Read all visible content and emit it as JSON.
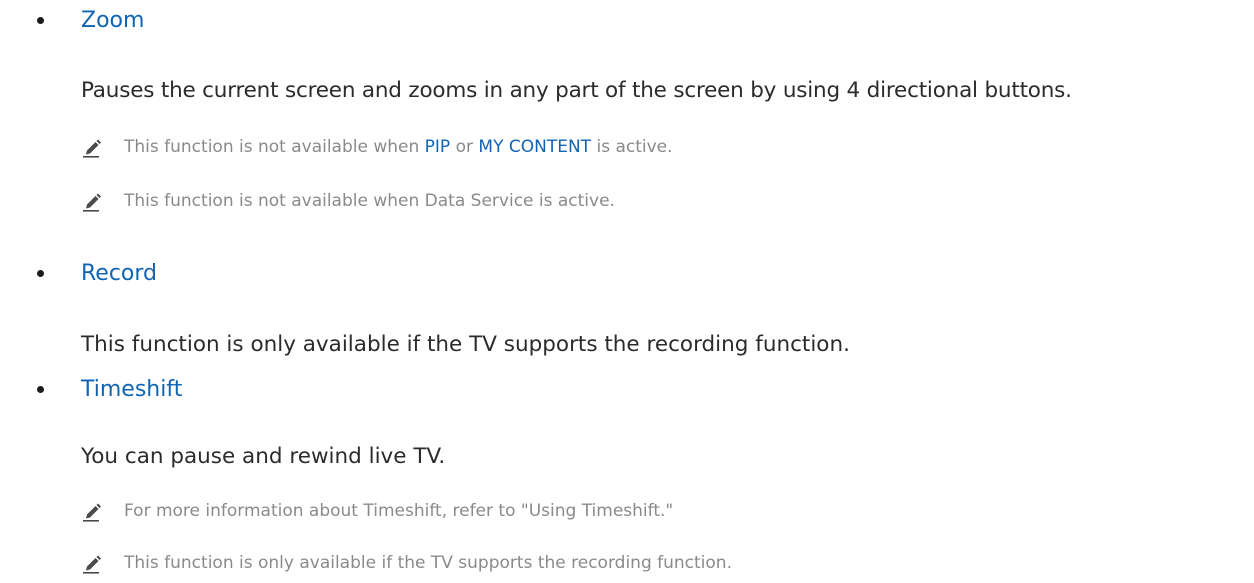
{
  "items": [
    {
      "heading": "Zoom",
      "description": "Pauses the current screen and zooms in any part of the screen by using 4 directional buttons.",
      "notes": [
        {
          "before": "This function is not available when ",
          "link1": "PIP",
          "between": " or ",
          "link2": "MY CONTENT",
          "after": " is active."
        },
        {
          "text": "This function is not available when Data Service is active."
        }
      ]
    },
    {
      "heading": "Record",
      "description": "This function is only available if the TV supports the recording function.",
      "notes": []
    },
    {
      "heading": "Timeshift",
      "description": "You can pause and rewind live TV.",
      "notes": [
        {
          "text": "For more information about Timeshift, refer to \"Using Timeshift.\""
        },
        {
          "text": "This function is only available if the TV supports the recording function."
        }
      ]
    }
  ],
  "icons": {
    "note": "pencil-note-icon",
    "bullet": "bullet-dot"
  },
  "colors": {
    "heading": "#1164b4",
    "body_text": "#2b2b2b",
    "note_text": "#8a8a8a",
    "icon": "#4a4a4a"
  }
}
